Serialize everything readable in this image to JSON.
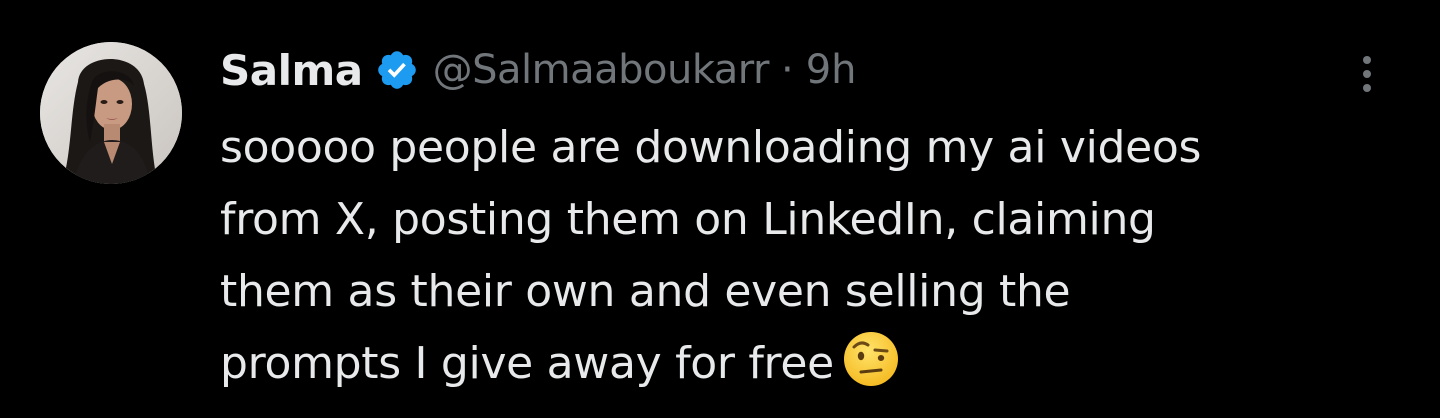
{
  "tweet": {
    "author": {
      "name": "Salma",
      "handle": "@Salmaaboukarr",
      "verified": true,
      "avatar_icon": "avatar-photo"
    },
    "separator": "·",
    "time": "9h",
    "more_icon": "more-vertical-icon",
    "text_lines": [
      "sooooo people are downloading my ai videos",
      "from X, posting them on LinkedIn, claiming",
      "them as their own and even selling the",
      "prompts I give away for free"
    ],
    "emoji": "face-with-raised-eyebrow-emoji"
  },
  "colors": {
    "background": "#000000",
    "primary_text": "#e7e9ea",
    "secondary_text": "#71767b",
    "verified_blue": "#1d9bf0"
  }
}
